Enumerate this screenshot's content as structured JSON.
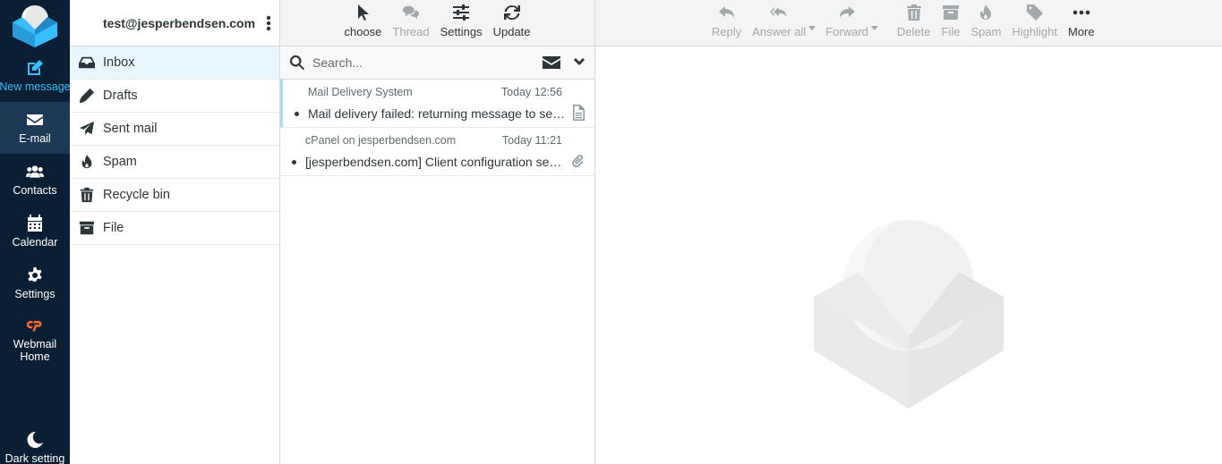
{
  "nav": {
    "items": [
      {
        "key": "compose",
        "label": "New message",
        "icon": "compose-icon"
      },
      {
        "key": "mail",
        "label": "E-mail",
        "icon": "envelope-icon"
      },
      {
        "key": "contacts",
        "label": "Contacts",
        "icon": "users-icon"
      },
      {
        "key": "calendar",
        "label": "Calendar",
        "icon": "calendar-icon"
      },
      {
        "key": "settings",
        "label": "Settings",
        "icon": "gear-icon"
      },
      {
        "key": "webmail",
        "label": "Webmail Home",
        "icon": "cpanel-icon"
      }
    ],
    "dark_mode_label": "Dark setting"
  },
  "account": {
    "email": "test@jesperbendsen.com"
  },
  "folders": [
    {
      "label": "Inbox",
      "icon": "inbox-icon"
    },
    {
      "label": "Drafts",
      "icon": "pencil-icon"
    },
    {
      "label": "Sent mail",
      "icon": "paper-plane-icon"
    },
    {
      "label": "Spam",
      "icon": "fire-icon"
    },
    {
      "label": "Recycle bin",
      "icon": "trash-icon"
    },
    {
      "label": "File",
      "icon": "archive-icon"
    }
  ],
  "list_toolbar": {
    "select": "choose",
    "thread": "Thread",
    "options": "Settings",
    "refresh": "Update"
  },
  "search": {
    "placeholder": "Search..."
  },
  "messages": [
    {
      "from": "Mail Delivery System",
      "date": "Today 12:56",
      "subject": "Mail delivery failed: returning message to sender",
      "attachment": "document-icon"
    },
    {
      "from": "cPanel on jesperbendsen.com",
      "date": "Today 11:21",
      "subject": "[jesperbendsen.com] Client configuration settings for \"test@jesperbendsen.com\"",
      "attachment": "paperclip-icon"
    }
  ],
  "message_toolbar": {
    "reply": "Reply",
    "reply_all": "Answer all",
    "forward": "Forward",
    "delete": "Delete",
    "archive": "File",
    "junk": "Spam",
    "flag": "Highlight",
    "more": "More"
  },
  "colors": {
    "nav_bg": "#0a1f33",
    "accent": "#37beff",
    "selected_folder": "#e8f7fd"
  }
}
